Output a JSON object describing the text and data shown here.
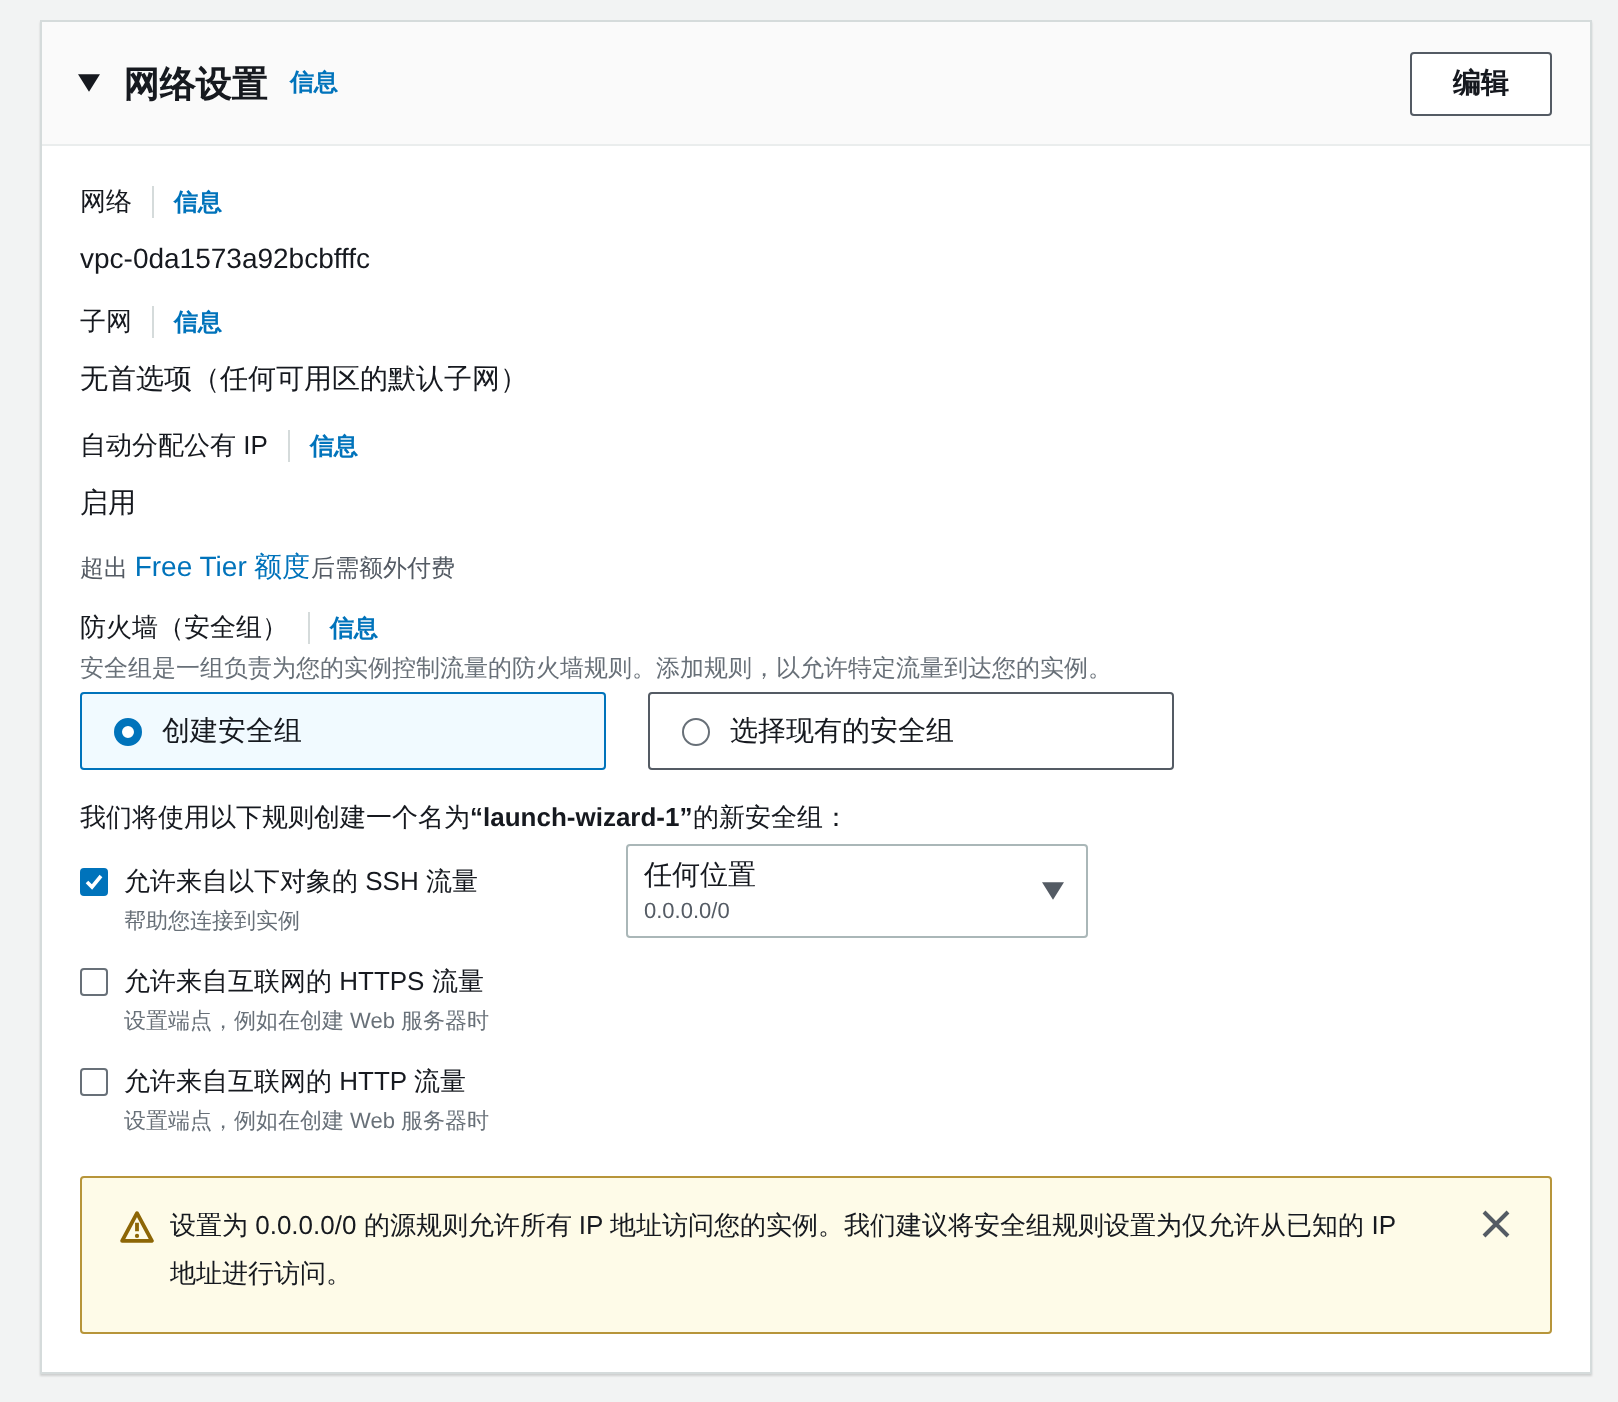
{
  "section": {
    "title": "网络设置",
    "info": "信息",
    "edit_button": "编辑",
    "expanded": true
  },
  "fields": [
    {
      "label": "网络",
      "info": "信息",
      "value": "vpc-0da1573a92bcbfffc"
    },
    {
      "label": "子网",
      "info": "信息",
      "value": "无首选项（任何可用区的默认子网）"
    },
    {
      "label": "自动分配公有 IP",
      "info": "信息",
      "value": "启用"
    }
  ],
  "free_tier_note": {
    "prefix": "超出",
    "link": "Free Tier 额度",
    "suffix": "后需额外付费"
  },
  "firewall": {
    "label": "防火墙（安全组）",
    "info": "信息",
    "description": "安全组是一组负责为您的实例控制流量的防火墙规则。添加规则，以允许特定流量到达您的实例。",
    "options": [
      {
        "label": "创建安全组",
        "selected": true
      },
      {
        "label": "选择现有的安全组",
        "selected": false
      }
    ],
    "rule_intro": "我们将使用以下规则创建一个名为**“launch-wizard-1”**的新安全组：",
    "rules": [
      {
        "label": "允许来自以下对象的 SSH 流量",
        "description": "帮助您连接到实例",
        "checked": true
      },
      {
        "label": "允许来自互联网的 HTTPS 流量",
        "description": "设置端点，例如在创建 Web 服务器时",
        "checked": false
      },
      {
        "label": "允许来自互联网的 HTTP 流量",
        "description": "设置端点，例如在创建 Web 服务器时",
        "checked": false
      }
    ],
    "source_select": {
      "value": "任何位置",
      "detail": "0.0.0.0/0"
    }
  },
  "warning": {
    "text": "设置为 0.0.0.0/0 的源规则允许所有 IP 地址访问您的实例。我们建议将安全组规则设置为仅允许从已知的 IP 地址进行访问。"
  }
}
